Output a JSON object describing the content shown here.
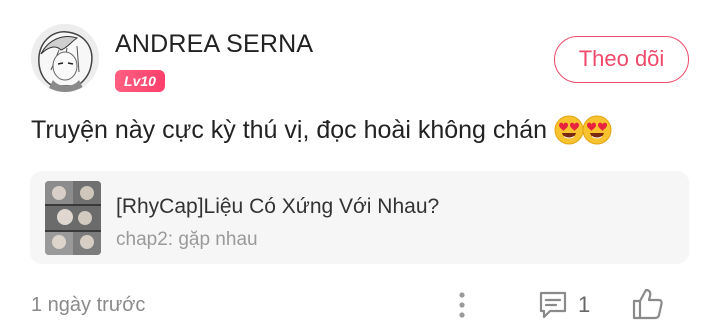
{
  "comment": {
    "user": {
      "name": "ANDREA SERNA",
      "level": "Lv10",
      "avatar_icon": "anime-avatar-icon"
    },
    "follow_label": "Theo dõi",
    "text": "Truyện này cực kỳ thú vị, đọc hoài không chán",
    "emojis": [
      "heart-eyes-emoji",
      "heart-eyes-emoji"
    ],
    "story": {
      "title": "[RhyCap]Liệu Có Xứng Với Nhau?",
      "chapter": "chap2: gặp nhau"
    },
    "time": "1 ngày trước",
    "reply_count": "1"
  },
  "colors": {
    "accent": "#ef4a6b",
    "badge": "#ff4f75",
    "card_bg": "#f6f6f7",
    "muted": "#8a8a8a"
  }
}
